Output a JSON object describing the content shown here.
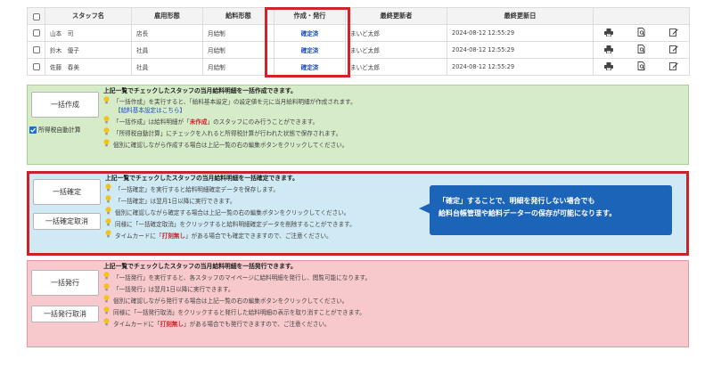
{
  "table": {
    "headers": [
      "",
      "スタッフ名",
      "雇用形態",
      "給料形態",
      "作成・発行",
      "最終更新者",
      "最終更新日",
      ""
    ],
    "rows": [
      {
        "name": "山本　司",
        "employment": "店長",
        "salary_type": "月給制",
        "status": "確定済",
        "updater": "まいど太郎",
        "updated_at": "2024-08-12 12:55:29"
      },
      {
        "name": "鈴木　優子",
        "employment": "社員",
        "salary_type": "月給制",
        "status": "確定済",
        "updater": "まいど太郎",
        "updated_at": "2024-08-12 12:55:29"
      },
      {
        "name": "佐藤　春美",
        "employment": "社員",
        "salary_type": "月給制",
        "status": "確定済",
        "updater": "まいど太郎",
        "updated_at": "2024-08-12 12:55:29"
      }
    ],
    "row_icons": [
      "printer-icon",
      "document-search-icon",
      "edit-icon"
    ]
  },
  "create_panel": {
    "button_label": "一括作成",
    "checkbox_label": "所得税自動計算",
    "checkbox_checked": true,
    "title": "上記一覧でチェックしたスタッフの当月給料明細を一括作成できます。",
    "line1": "「一括作成」を実行すると、「給料基本設定」の設定値を元に当月給料明細が作成されます。",
    "link": "【給料基本設定はこちら】",
    "line2_pre": "「一括作成」は給料明細が「",
    "line2_red": "未作成",
    "line2_post": "」のスタッフにのみ行うことができます。",
    "line3": "「所得税自動計算」にチェックを入れると所得税計算が行われた状態で保存されます。",
    "line4": "個別に確認しながら作成する場合は上記一覧の右の編集ボタンをクリックしてください。"
  },
  "confirm_panel": {
    "button_label": "一括確定",
    "cancel_label": "一括確定取消",
    "title": "上記一覧でチェックしたスタッフの当月給料明細を一括確定できます。",
    "line1": "「一括確定」を実行すると給料明細確定データを保存します。",
    "line2": "「一括確定」は翌月1日以降に実行できます。",
    "line3": "個別に確認しながら確定する場合は上記一覧の右の編集ボタンをクリックしてください。",
    "line4": "同様に「一括確定取消」をクリックすると給料明細確定データを削除することができます。",
    "line5_pre": "タイムカードに「",
    "line5_red": "打刻無し",
    "line5_post": "」がある場合でも確定できますので、ご注意ください。"
  },
  "issue_panel": {
    "button_label": "一括発行",
    "cancel_label": "一括発行取消",
    "title": "上記一覧でチェックしたスタッフの当月給料明細を一括発行できます。",
    "line1": "「一括発行」を実行すると、各スタッフのマイページに給料明細を発行し、閲覧可能になります。",
    "line2": "「一括発行」は翌月1日以降に実行できます。",
    "line3": "個別に確認しながら発行する場合は上記一覧の右の編集ボタンをクリックしてください。",
    "line4": "同様に「一括発行取消」をクリックすると発行した給料明細の表示を取り消すことができます。",
    "line5_pre": "タイムカードに「",
    "line5_red": "打刻無し",
    "line5_post": "」がある場合でも発行できますので、ご注意ください。"
  },
  "callout": {
    "line1": "「確定」することで、明細を発行しない場合でも",
    "line2": "給料台帳管理や給料データーの保存が可能になります。"
  },
  "colors": {
    "accent_red": "#d2232a",
    "link_blue": "#1a4fb8",
    "callout_blue": "#1c64b8",
    "create_bg": "#d6ecc8",
    "confirm_bg": "#cfeaf4",
    "issue_bg": "#f7c9cc",
    "bulb_yellow": "#f3c21b"
  }
}
